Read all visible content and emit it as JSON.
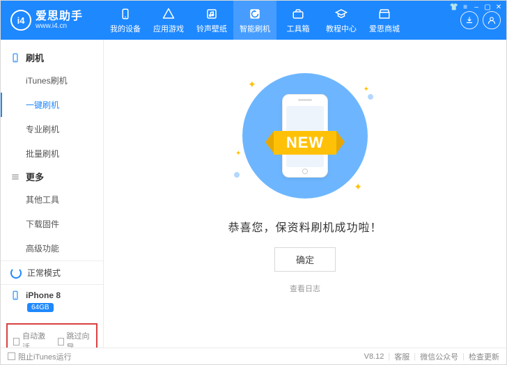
{
  "brand": {
    "name": "爱思助手",
    "url": "www.i4.cn",
    "badge": "i4"
  },
  "nav": [
    {
      "label": "我的设备",
      "icon": "device"
    },
    {
      "label": "应用游戏",
      "icon": "apps"
    },
    {
      "label": "铃声壁纸",
      "icon": "music"
    },
    {
      "label": "智能刷机",
      "icon": "flash",
      "active": true
    },
    {
      "label": "工具箱",
      "icon": "toolbox"
    },
    {
      "label": "教程中心",
      "icon": "school"
    },
    {
      "label": "爱思商城",
      "icon": "store"
    }
  ],
  "sidebar": {
    "groups": [
      {
        "title": "刷机",
        "icon": "phone",
        "items": [
          {
            "label": "iTunes刷机"
          },
          {
            "label": "一键刷机",
            "active": true
          },
          {
            "label": "专业刷机"
          },
          {
            "label": "批量刷机"
          }
        ]
      },
      {
        "title": "更多",
        "icon": "menu",
        "items": [
          {
            "label": "其他工具"
          },
          {
            "label": "下载固件"
          },
          {
            "label": "高级功能"
          }
        ]
      }
    ],
    "mode": "正常模式",
    "device": {
      "name": "iPhone 8",
      "storage": "64GB"
    },
    "options": {
      "auto_activate": "自动激活",
      "skip_guide": "跳过向导"
    }
  },
  "main": {
    "ribbon": "NEW",
    "success": "恭喜您，保资料刷机成功啦！",
    "ok": "确定",
    "view_log": "查看日志"
  },
  "status": {
    "block_itunes": "阻止iTunes运行",
    "version": "V8.12",
    "support": "客服",
    "wechat": "微信公众号",
    "check_update": "检查更新"
  }
}
